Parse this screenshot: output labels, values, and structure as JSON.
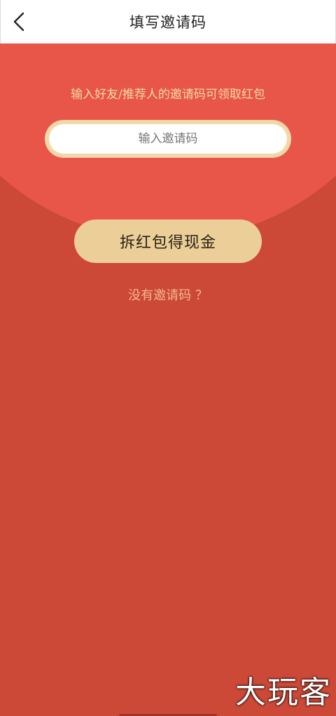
{
  "nav": {
    "title": "填写邀请码",
    "back_icon": "chevron-left-icon"
  },
  "main": {
    "hint": "输入好友/推荐人的邀请码可领取红包",
    "input_placeholder": "输入邀请码",
    "input_value": "",
    "redeem_label": "拆红包得现金",
    "no_code_link": "没有邀请码 ？"
  },
  "watermark": "大玩客",
  "colors": {
    "background_red": "#cc4837",
    "curve_red": "#e8564a",
    "gold": "#eccf98",
    "hint_text": "#f5d9a8",
    "link_text": "#f2b98a"
  }
}
